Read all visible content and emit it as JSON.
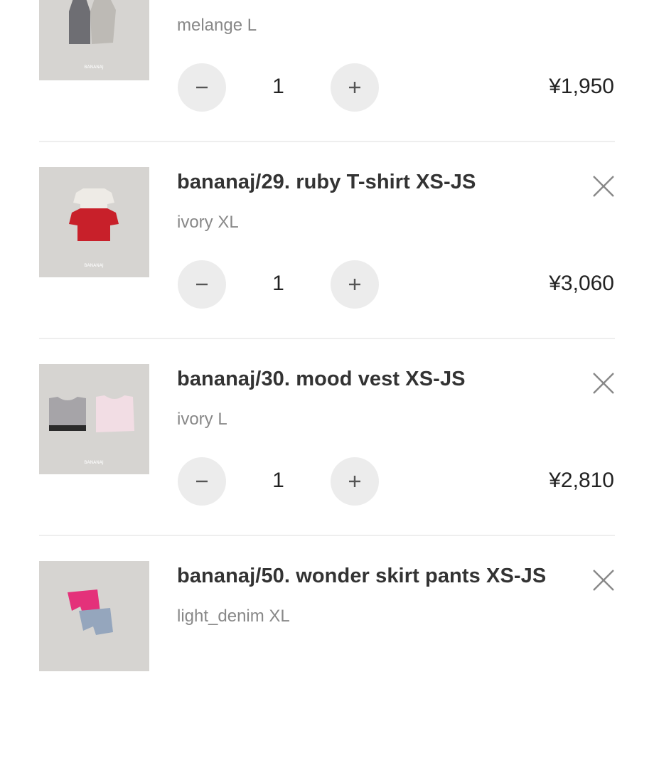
{
  "cart": {
    "items": [
      {
        "title": "",
        "variant": "melange L",
        "quantity": "1",
        "price": "¥1,950",
        "thumbnail_icon": "tank-tops-product-image"
      },
      {
        "title": "bananaj/29. ruby T-shirt XS-JS",
        "variant": "ivory XL",
        "quantity": "1",
        "price": "¥3,060",
        "thumbnail_icon": "t-shirts-product-image"
      },
      {
        "title": "bananaj/30. mood vest XS-JS",
        "variant": "ivory L",
        "quantity": "1",
        "price": "¥2,810",
        "thumbnail_icon": "vests-product-image"
      },
      {
        "title": "bananaj/50. wonder skirt pants XS-JS",
        "variant": "light_denim XL",
        "quantity": "",
        "price": "",
        "thumbnail_icon": "skirt-pants-product-image"
      }
    ]
  },
  "colors": {
    "button_bg": "#ececec",
    "divider": "#eeeeee",
    "variant_text": "#888888",
    "thumb_bg": "#d6d4d1"
  }
}
